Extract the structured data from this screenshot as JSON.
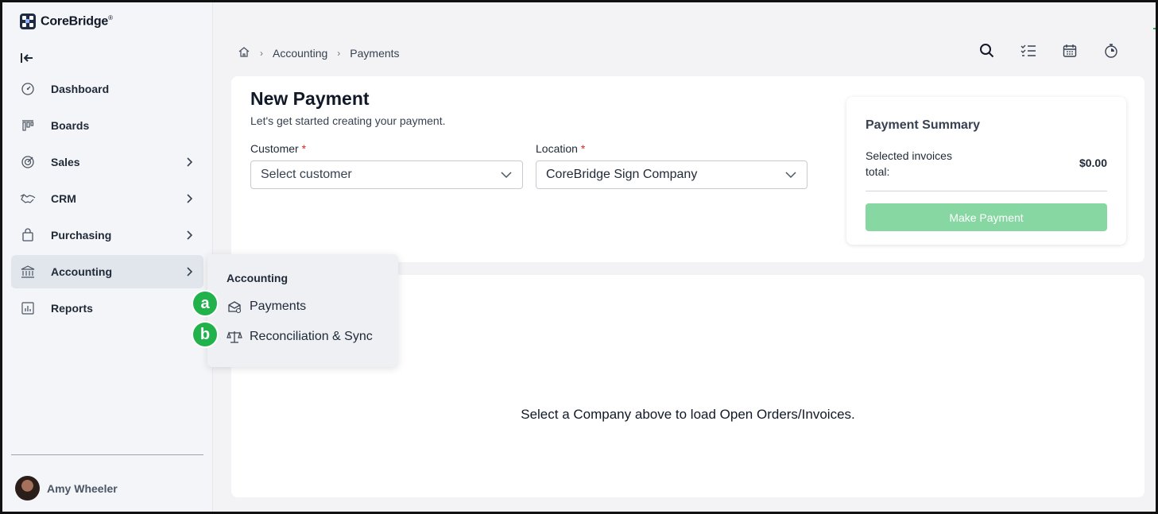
{
  "app": {
    "name": "CoreBridge",
    "trademark": "®"
  },
  "sidebar": {
    "items": [
      {
        "label": "Dashboard",
        "icon": "dashboard-icon",
        "has_children": false
      },
      {
        "label": "Boards",
        "icon": "boards-icon",
        "has_children": false
      },
      {
        "label": "Sales",
        "icon": "sales-icon",
        "has_children": true
      },
      {
        "label": "CRM",
        "icon": "handshake-icon",
        "has_children": true
      },
      {
        "label": "Purchasing",
        "icon": "shopping-bag-icon",
        "has_children": true
      },
      {
        "label": "Accounting",
        "icon": "bank-icon",
        "has_children": true,
        "active": true
      },
      {
        "label": "Reports",
        "icon": "reports-icon",
        "has_children": false
      }
    ],
    "user": {
      "name": "Amy Wheeler"
    }
  },
  "breadcrumb": {
    "items": [
      "Accounting",
      "Payments"
    ]
  },
  "page": {
    "title": "New Payment",
    "subtitle": "Let's get started creating your payment."
  },
  "form": {
    "customer": {
      "label": "Customer",
      "required_mark": "*",
      "value": "Select customer"
    },
    "location": {
      "label": "Location",
      "required_mark": "*",
      "value": "CoreBridge Sign Company"
    }
  },
  "summary": {
    "title": "Payment Summary",
    "label": "Selected invoices total:",
    "value": "$0.00",
    "button": "Make Payment"
  },
  "empty_state": "Select a Company above to load Open Orders/Invoices.",
  "flyout": {
    "title": "Accounting",
    "items": [
      {
        "label": "Payments",
        "badge": "a",
        "icon": "payments-icon"
      },
      {
        "label": "Reconciliation & Sync",
        "badge": "b",
        "icon": "scale-icon"
      }
    ]
  },
  "colors": {
    "accent_green": "#22b24c",
    "button_disabled": "#86d7a2",
    "required": "#dc2626"
  }
}
